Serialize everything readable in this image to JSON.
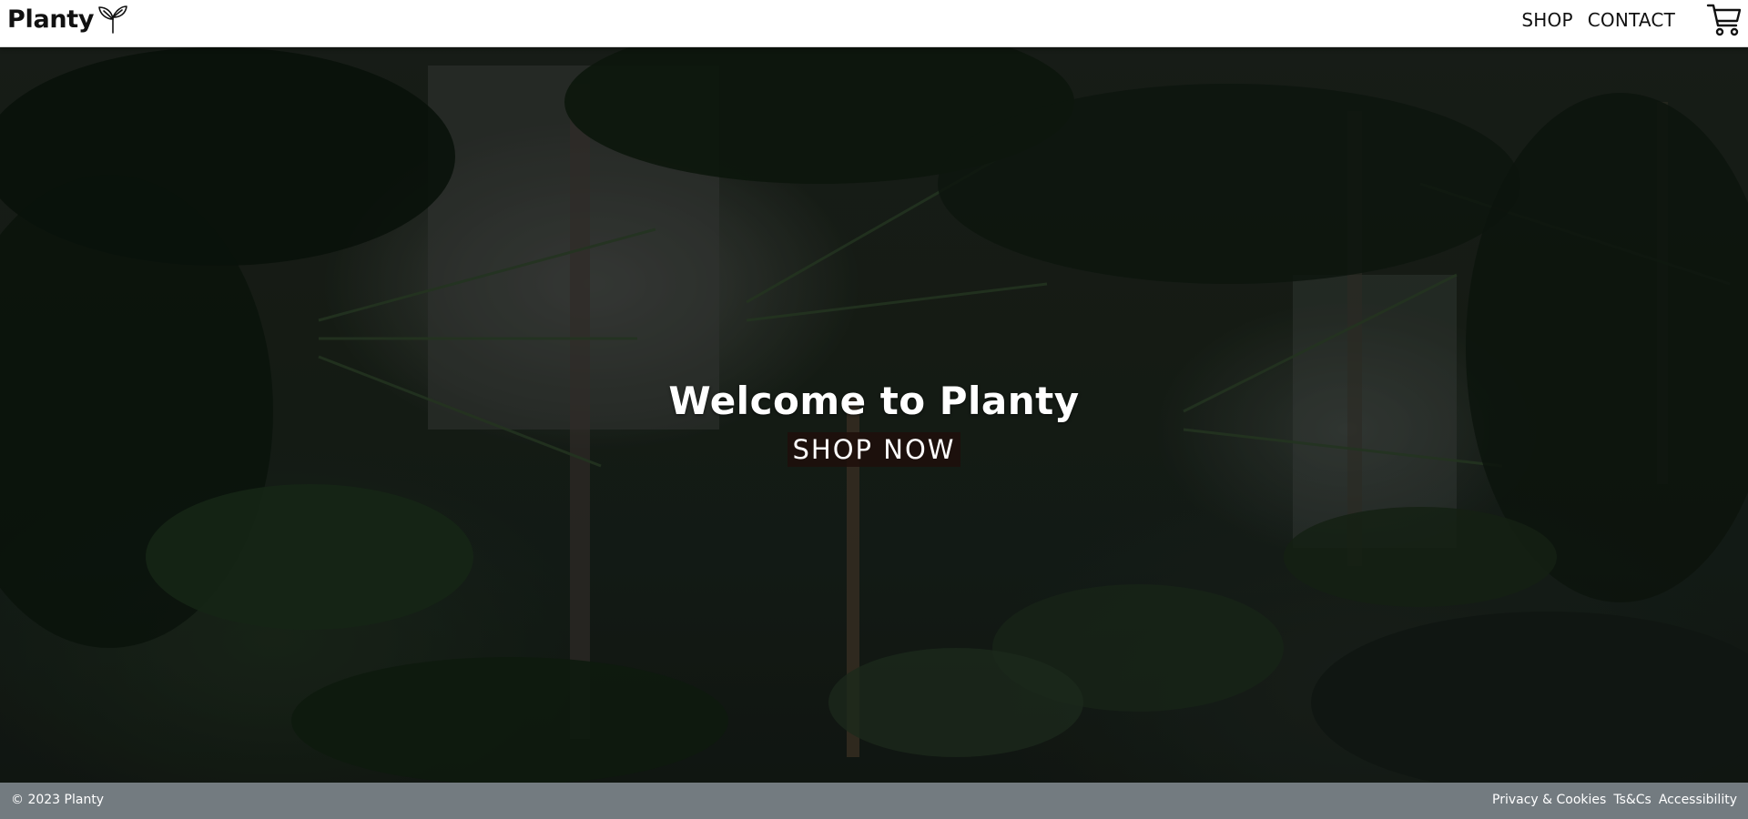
{
  "header": {
    "brand": "Planty",
    "brand_icon": "sprout-icon",
    "nav": [
      {
        "label": "SHOP"
      },
      {
        "label": "CONTACT"
      }
    ],
    "cart_icon": "cart-icon"
  },
  "hero": {
    "title": "Welcome to Planty",
    "cta_label": "SHOP NOW",
    "background_image": "jungle-foliage"
  },
  "footer": {
    "copyright": "© 2023 Planty",
    "links": [
      {
        "label": "Privacy & Cookies"
      },
      {
        "label": "Ts&Cs"
      },
      {
        "label": "Accessibility"
      }
    ]
  },
  "colors": {
    "header_bg": "#ffffff",
    "footer_bg": "#737b80",
    "cta_bg": "#1e0e0a",
    "text_light": "#ffffff",
    "text_dark": "#111111"
  }
}
